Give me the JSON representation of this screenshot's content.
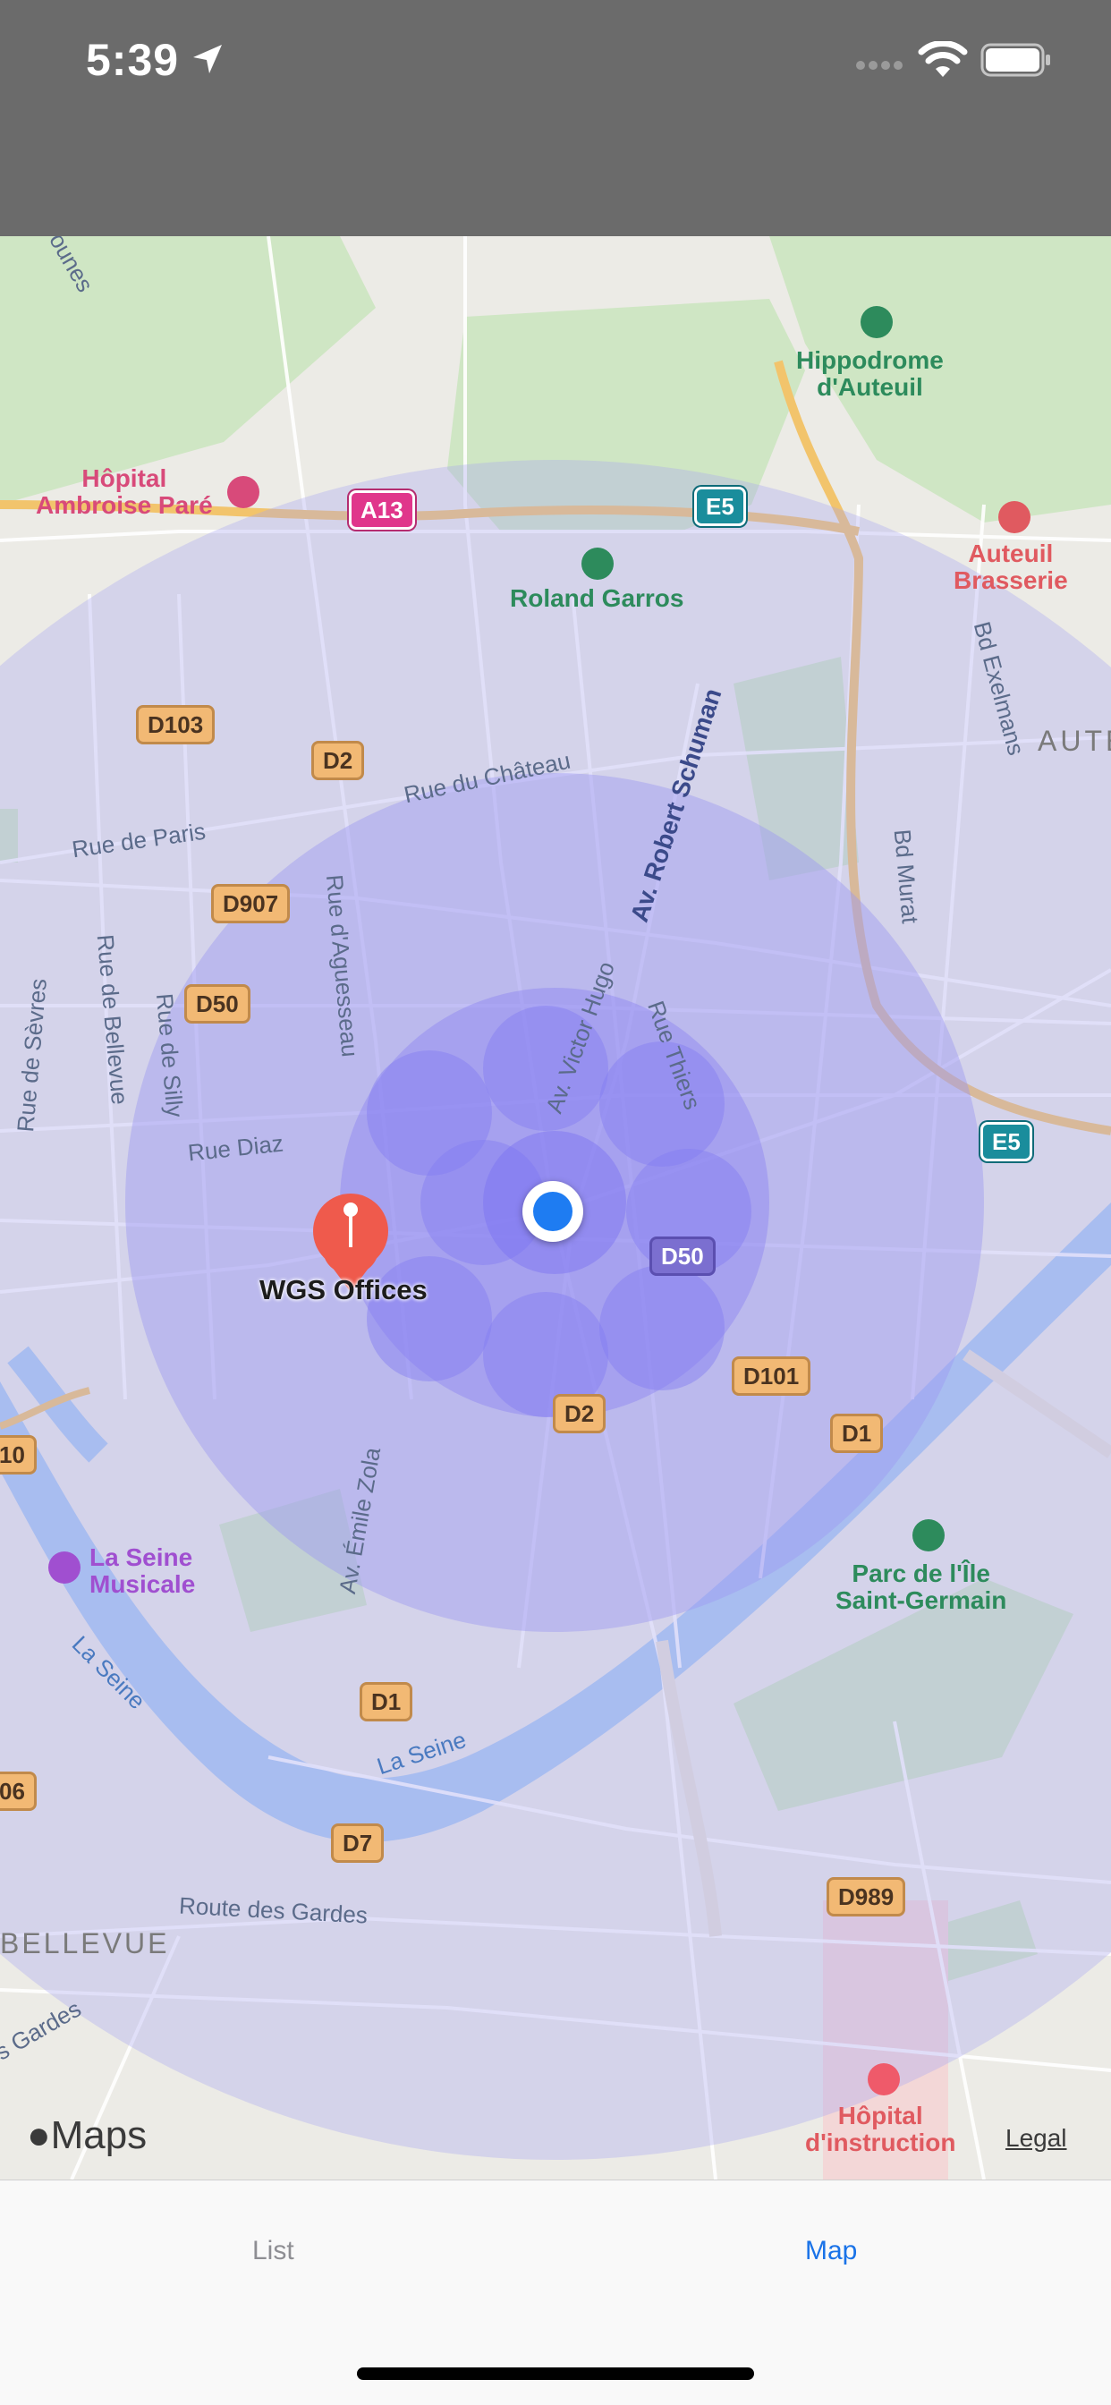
{
  "status_bar": {
    "time": "5:39",
    "icons": [
      "location-arrow-icon",
      "signal-icon",
      "wifi-icon",
      "battery-icon"
    ]
  },
  "map": {
    "pin_label": "WGS Offices",
    "places": {
      "hippodrome": "Hippodrome\nd'Auteuil",
      "hopital_ambroise": "Hôpital\nAmbroise Paré",
      "roland_garros": "Roland Garros",
      "auteuil_brasserie": "Auteuil\nBrasserie",
      "auteuil": "AUTE",
      "la_seine_musicale": "La Seine\nMusicale",
      "parc_ile": "Parc de l'Île\nSaint-Germain",
      "hopital_instruction": "Hôpital\nd'instruction",
      "bellevue": "BELLEVUE"
    },
    "roads": {
      "rue_chateau": "Rue du Château",
      "rue_paris": "Rue de Paris",
      "av_robert_schuman": "Av. Robert Schuman",
      "rue_aguesseau": "Rue d'Aguesseau",
      "rue_sevres": "Rue de Sèvres",
      "rue_bellevue": "Rue de Bellevue",
      "rue_silly": "Rue de Silly",
      "rue_diaz": "Rue Diaz",
      "av_victor_hugo": "Av. Victor Hugo",
      "rue_thiers": "Rue Thiers",
      "bd_exelmans": "Bd Exelmans",
      "bd_murat": "Bd Murat",
      "av_emile_zola": "Av. Émile Zola",
      "la_seine_1": "La Seine",
      "la_seine_2": "La Seine",
      "route_gardes": "Route des Gardes",
      "gardes": "s Gardes",
      "dunes": "ounes"
    },
    "shields": {
      "a13": "A13",
      "e5_top": "E5",
      "e5_right": "E5",
      "d103": "D103",
      "d2_top": "D2",
      "d907": "D907",
      "d50_left": "D50",
      "d50_right": "D50",
      "d101": "D101",
      "d1_right": "D1",
      "d2_bottom": "D2",
      "d1_bottom": "D1",
      "d7": "D7",
      "d989": "D989",
      "cut_10": "10",
      "cut_06": "06"
    },
    "attribution": "Maps",
    "legal": "Legal"
  },
  "tab_bar": {
    "tabs": [
      {
        "label": "List",
        "selected": false
      },
      {
        "label": "Map",
        "selected": true
      }
    ],
    "accent_color": "#1a73e8",
    "inactive_color": "#8e8e93"
  }
}
